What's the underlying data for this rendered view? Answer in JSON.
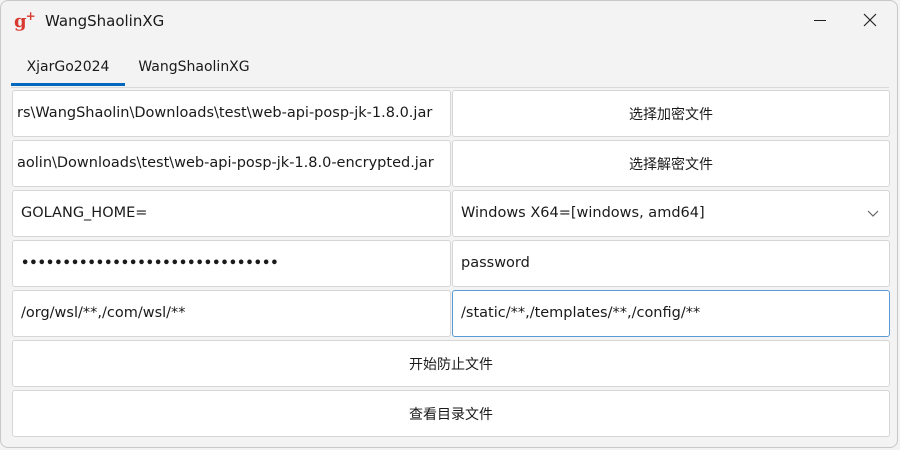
{
  "window": {
    "title": "WangShaolinXG",
    "icon": "g-plus-icon"
  },
  "tabs": [
    {
      "label": "XjarGo2024"
    },
    {
      "label": "WangShaolinXG"
    }
  ],
  "form": {
    "input_file": "rs\\WangShaolin\\Downloads\\test\\web-api-posp-jk-1.8.0.jar",
    "select_encrypt_button": "选择加密文件",
    "output_file": "aolin\\Downloads\\test\\web-api-posp-jk-1.8.0-encrypted.jar",
    "select_decrypt_button": "选择解密文件",
    "golang_home": "GOLANG_HOME=",
    "platform_select": "Windows X64=[windows, amd64]",
    "password_value": "•••••••••••••••••••••••••••••••",
    "password_placeholder": "password",
    "include_paths": "/org/wsl/**,/com/wsl/**",
    "exclude_paths": "/static/**,/templates/**,/config/**",
    "start_button": "开始防止文件",
    "view_button": "查看目录文件"
  }
}
